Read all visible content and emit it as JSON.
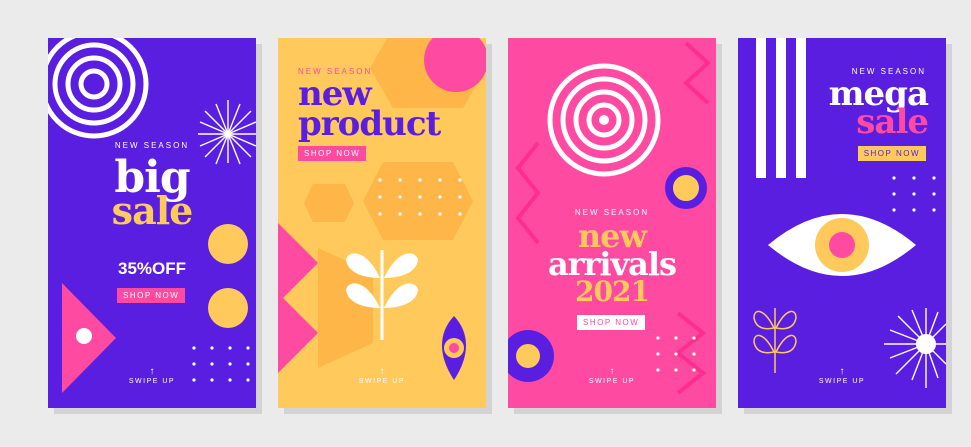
{
  "colors": {
    "purple": "#5a1ee0",
    "yellow": "#ffc95c",
    "pink": "#ff4aa2",
    "hotpink": "#ff2e8e",
    "white": "#ffffff",
    "background": "#ebebeb"
  },
  "cards": [
    {
      "kicker": "NEW SEASON",
      "title_line1": "big",
      "title_line2": "sale",
      "discount": "35%OFF",
      "button": "SHOP NOW",
      "swipe": "SWIPE UP"
    },
    {
      "kicker": "NEW SEASON",
      "title_line1": "new",
      "title_line2": "product",
      "button": "SHOP NOW",
      "swipe": "SWIPE UP"
    },
    {
      "kicker": "NEW SEASON",
      "title_line1": "new",
      "title_line2": "arrivals",
      "title_line3": "2021",
      "button": "SHOP NOW",
      "swipe": "SWIPE UP"
    },
    {
      "kicker": "NEW SEASON",
      "title_line1": "mega",
      "title_line2": "sale",
      "button": "SHOP NOW",
      "swipe": "SWIPE UP"
    }
  ]
}
